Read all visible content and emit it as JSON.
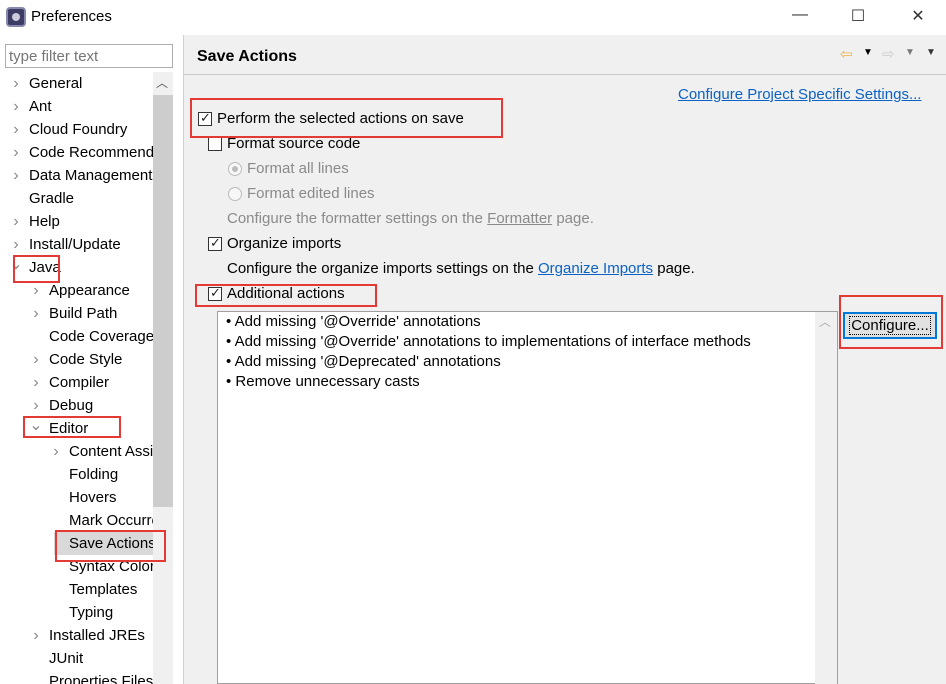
{
  "window": {
    "title": "Preferences",
    "minimize": "—",
    "maximize": "☐",
    "close": "✕"
  },
  "filter": {
    "placeholder": "type filter text"
  },
  "tree": [
    {
      "label": "General",
      "level": 0,
      "state": "collapsed"
    },
    {
      "label": "Ant",
      "level": 0,
      "state": "collapsed"
    },
    {
      "label": "Cloud Foundry",
      "level": 0,
      "state": "collapsed"
    },
    {
      "label": "Code Recommenders",
      "level": 0,
      "state": "collapsed"
    },
    {
      "label": "Data Management",
      "level": 0,
      "state": "collapsed"
    },
    {
      "label": "Gradle",
      "level": 0,
      "state": "leaf"
    },
    {
      "label": "Help",
      "level": 0,
      "state": "collapsed"
    },
    {
      "label": "Install/Update",
      "level": 0,
      "state": "collapsed"
    },
    {
      "label": "Java",
      "level": 0,
      "state": "expanded"
    },
    {
      "label": "Appearance",
      "level": 1,
      "state": "collapsed"
    },
    {
      "label": "Build Path",
      "level": 1,
      "state": "collapsed"
    },
    {
      "label": "Code Coverage",
      "level": 1,
      "state": "leaf"
    },
    {
      "label": "Code Style",
      "level": 1,
      "state": "collapsed"
    },
    {
      "label": "Compiler",
      "level": 1,
      "state": "collapsed"
    },
    {
      "label": "Debug",
      "level": 1,
      "state": "collapsed"
    },
    {
      "label": "Editor",
      "level": 1,
      "state": "expanded"
    },
    {
      "label": "Content Assist",
      "level": 2,
      "state": "collapsed"
    },
    {
      "label": "Folding",
      "level": 2,
      "state": "leaf"
    },
    {
      "label": "Hovers",
      "level": 2,
      "state": "leaf"
    },
    {
      "label": "Mark Occurrences",
      "level": 2,
      "state": "leaf"
    },
    {
      "label": "Save Actions",
      "level": 2,
      "state": "leaf",
      "selected": true
    },
    {
      "label": "Syntax Coloring",
      "level": 2,
      "state": "leaf"
    },
    {
      "label": "Templates",
      "level": 2,
      "state": "leaf"
    },
    {
      "label": "Typing",
      "level": 2,
      "state": "leaf"
    },
    {
      "label": "Installed JREs",
      "level": 1,
      "state": "collapsed"
    },
    {
      "label": "JUnit",
      "level": 1,
      "state": "leaf"
    },
    {
      "label": "Properties Files Editor",
      "level": 1,
      "state": "leaf"
    }
  ],
  "page": {
    "title": "Save Actions",
    "configure_project_link": "Configure Project Specific Settings...",
    "perform": {
      "label": "Perform the selected actions on save",
      "checked": true
    },
    "format_source": {
      "label": "Format source code",
      "checked": false
    },
    "format_all": {
      "label": "Format all lines",
      "selected": true,
      "enabled": false
    },
    "format_edited": {
      "label": "Format edited lines",
      "selected": false,
      "enabled": false
    },
    "formatter_note": {
      "pre": "Configure the formatter settings on the ",
      "link": "Formatter",
      "post": " page."
    },
    "organize": {
      "label": "Organize imports",
      "checked": true
    },
    "organize_note": {
      "pre": "Configure the organize imports settings on the ",
      "link": "Organize Imports",
      "post": " page."
    },
    "additional": {
      "label": "Additional actions",
      "checked": true
    },
    "actions": [
      "Add missing '@Override' annotations",
      "Add missing '@Override' annotations to implementations of interface methods",
      "Add missing '@Deprecated' annotations",
      "Remove unnecessary casts"
    ],
    "configure_button": "Configure..."
  },
  "colors": {
    "link": "#0b62c4",
    "highlight": "#e53935",
    "focus": "#0078d7"
  }
}
